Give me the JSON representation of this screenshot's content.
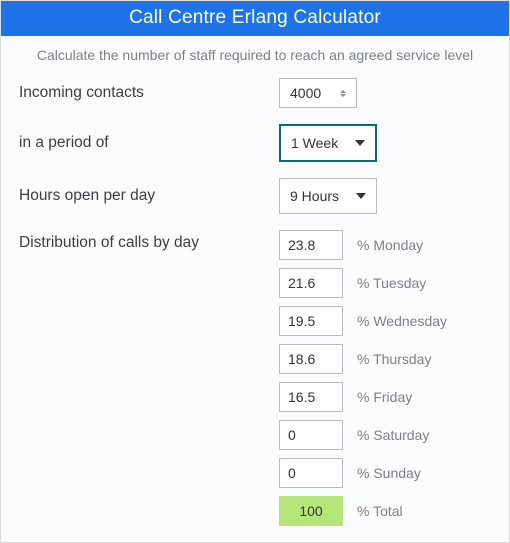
{
  "header": {
    "title": "Call Centre Erlang Calculator"
  },
  "subtitle": "Calculate the number of staff required to reach an agreed service level",
  "labels": {
    "incoming": "Incoming contacts",
    "period": "in a period of",
    "hours": "Hours open per day",
    "distribution": "Distribution of calls by day"
  },
  "fields": {
    "incoming_value": "4000",
    "period_value": "1 Week",
    "hours_value": "9 Hours"
  },
  "distribution": [
    {
      "value": "23.8",
      "suffix": "% Monday"
    },
    {
      "value": "21.6",
      "suffix": "% Tuesday"
    },
    {
      "value": "19.5",
      "suffix": "% Wednesday"
    },
    {
      "value": "18.6",
      "suffix": "% Thursday"
    },
    {
      "value": "16.5",
      "suffix": "% Friday"
    },
    {
      "value": "0",
      "suffix": "% Saturday"
    },
    {
      "value": "0",
      "suffix": "% Sunday"
    }
  ],
  "total": {
    "value": "100",
    "suffix": "% Total"
  }
}
